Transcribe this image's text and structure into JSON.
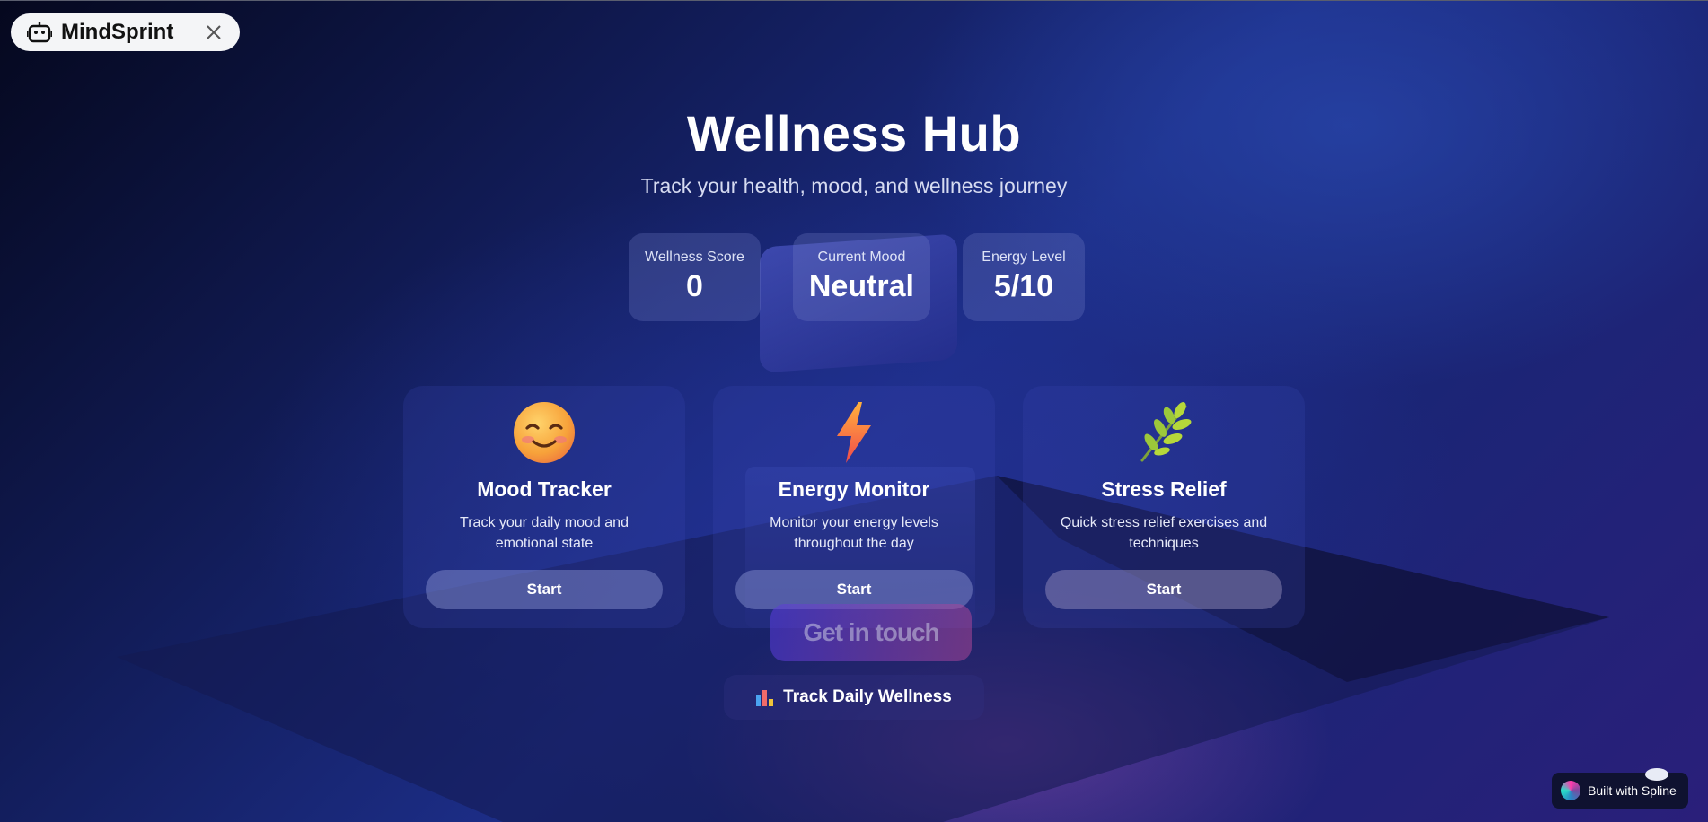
{
  "brand": {
    "name": "MindSprint",
    "icon": "robot-icon",
    "close_icon": "close-icon"
  },
  "header": {
    "title": "Wellness Hub",
    "subtitle": "Track your health, mood, and wellness journey"
  },
  "stats": [
    {
      "label": "Wellness Score",
      "value": "0"
    },
    {
      "label": "Current Mood",
      "value": "Neutral"
    },
    {
      "label": "Energy Level",
      "value": "5/10"
    }
  ],
  "features": [
    {
      "icon": "smiling-face-icon",
      "title": "Mood Tracker",
      "description": "Track your daily mood and emotional state",
      "button": "Start"
    },
    {
      "icon": "lightning-bolt-icon",
      "title": "Energy Monitor",
      "description": "Monitor your energy levels throughout the day",
      "button": "Start"
    },
    {
      "icon": "herb-leaf-icon",
      "title": "Stress Relief",
      "description": "Quick stress relief exercises and techniques",
      "button": "Start"
    }
  ],
  "cta": {
    "get_in_touch": "Get in touch",
    "track_daily": "Track Daily Wellness",
    "track_icon": "bar-chart-icon"
  },
  "badge": {
    "label": "Built with Spline"
  },
  "colors": {
    "background_dark": "#05081e",
    "background_blue": "#1c2d86",
    "pill_bg": "#f4f5f7",
    "button_bg": "#7f89c8"
  }
}
